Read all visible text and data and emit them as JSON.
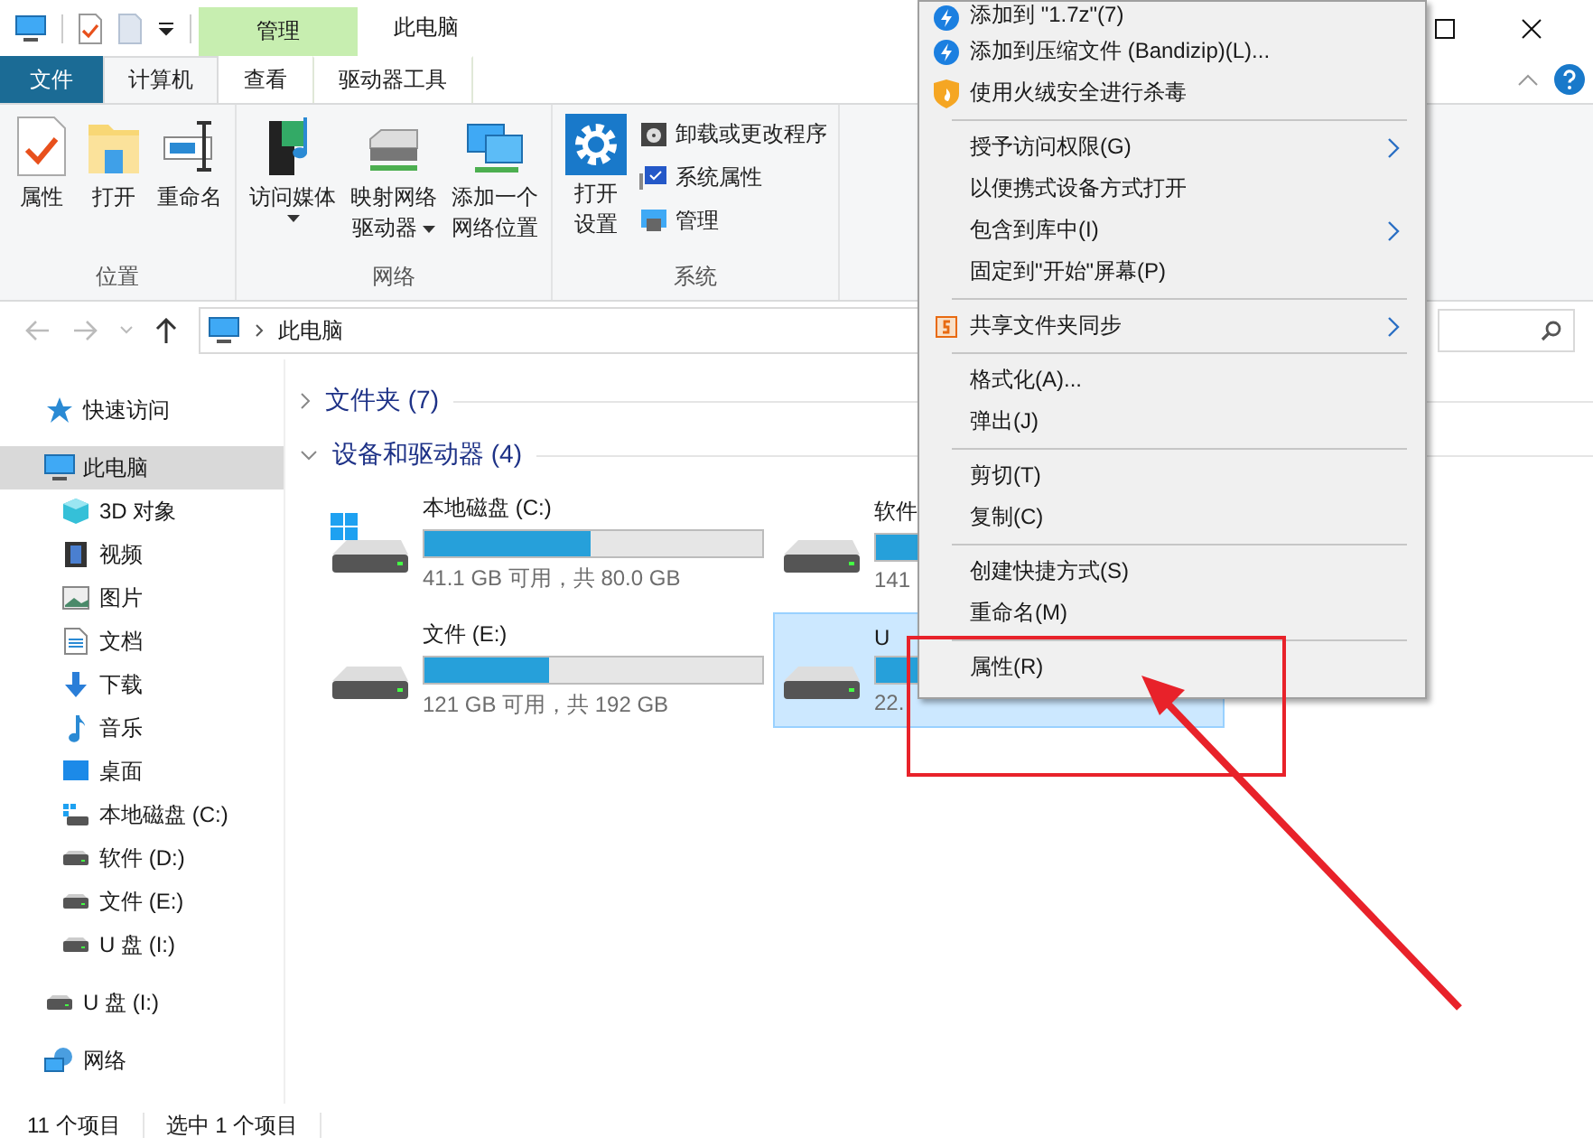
{
  "window": {
    "title": "此电脑",
    "context_tab_group": "管理"
  },
  "tabs": [
    {
      "label": "文件",
      "kind": "file",
      "selected": false
    },
    {
      "label": "计算机",
      "kind": "tab",
      "selected": true
    },
    {
      "label": "查看",
      "kind": "tab",
      "selected": false
    },
    {
      "label": "驱动器工具",
      "kind": "context",
      "selected": false
    }
  ],
  "ribbon": [
    {
      "label": "位置",
      "buttons": [
        {
          "lines": [
            "属性"
          ],
          "kind": "props",
          "dropdown": false
        },
        {
          "lines": [
            "打开"
          ],
          "kind": "folder",
          "dropdown": false
        },
        {
          "lines": [
            "重命名"
          ],
          "kind": "rename",
          "dropdown": false
        }
      ]
    },
    {
      "label": "网络",
      "buttons": [
        {
          "lines": [
            "访问媒体"
          ],
          "kind": "media",
          "dropdown": true
        },
        {
          "lines": [
            "映射网络",
            "驱动器"
          ],
          "kind": "drive",
          "dropdown": true
        },
        {
          "lines": [
            "添加一个",
            "网络位置"
          ],
          "kind": "monitors",
          "dropdown": false
        }
      ]
    },
    {
      "label": "系统",
      "buttons": [
        {
          "lines": [
            "打开",
            "设置"
          ],
          "kind": "gear",
          "dropdown": false
        }
      ],
      "small": [
        {
          "label": "卸载或更改程序",
          "kind": "uninstall"
        },
        {
          "label": "系统属性",
          "kind": "sysprops"
        },
        {
          "label": "管理",
          "kind": "manage"
        }
      ]
    }
  ],
  "address": {
    "path": "此电脑"
  },
  "sidebar": [
    {
      "label": "快速访问",
      "kind": "star",
      "selected": false
    },
    {
      "label": "此电脑",
      "kind": "pc",
      "selected": true,
      "children": [
        {
          "label": "3D 对象",
          "kind": "cube",
          "selected": false
        },
        {
          "label": "视频",
          "kind": "film",
          "selected": false
        },
        {
          "label": "图片",
          "kind": "image",
          "selected": false
        },
        {
          "label": "文档",
          "kind": "doc",
          "selected": false
        },
        {
          "label": "下载",
          "kind": "download",
          "selected": false
        },
        {
          "label": "音乐",
          "kind": "music",
          "selected": false
        },
        {
          "label": "桌面",
          "kind": "desktop",
          "selected": false
        },
        {
          "label": "本地磁盘 (C:)",
          "kind": "windrive",
          "selected": false
        },
        {
          "label": "软件 (D:)",
          "kind": "drive",
          "selected": false
        },
        {
          "label": "文件 (E:)",
          "kind": "drive",
          "selected": false
        },
        {
          "label": "U 盘 (I:)",
          "kind": "drive",
          "selected": false
        }
      ]
    },
    {
      "label": "U 盘 (I:)",
      "kind": "drive",
      "selected": false
    },
    {
      "label": "网络",
      "kind": "network",
      "selected": false
    }
  ],
  "groups": [
    {
      "title": "文件夹 (7)",
      "expanded": false
    },
    {
      "title": "设备和驱动器 (4)",
      "expanded": true
    }
  ],
  "drives": [
    {
      "name": "本地磁盘 (C:)",
      "free": "41.1 GB 可用，共 80.0 GB",
      "level": 0.49,
      "kind": "windrive",
      "selected": false
    },
    {
      "name": "软件",
      "free": "141",
      "kind": "drive",
      "selected": false
    },
    {
      "name": "文件 (E:)",
      "free": "121 GB 可用，共 192 GB",
      "level": 0.37,
      "kind": "drive",
      "selected": false
    },
    {
      "name": "U",
      "free": "22.",
      "kind": "drive",
      "selected": true
    }
  ],
  "context_menu": [
    {
      "label": "添加到 \"1.7z\"(7)",
      "kind": "zip",
      "submenu": false
    },
    {
      "label": "添加到压缩文件 (Bandizip)(L)...",
      "kind": "zip",
      "submenu": false
    },
    {
      "label": "使用火绒安全进行杀毒",
      "kind": "shield",
      "submenu": false
    },
    {
      "kind": "separator"
    },
    {
      "label": "授予访问权限(G)",
      "kind": "plain",
      "submenu": true
    },
    {
      "label": "以便携式设备方式打开",
      "kind": "plain",
      "submenu": false
    },
    {
      "label": "包含到库中(I)",
      "kind": "plain",
      "submenu": true
    },
    {
      "label": "固定到\"开始\"屏幕(P)",
      "kind": "plain",
      "submenu": false
    },
    {
      "kind": "separator"
    },
    {
      "label": "共享文件夹同步",
      "kind": "sync",
      "submenu": true
    },
    {
      "kind": "separator"
    },
    {
      "label": "格式化(A)...",
      "kind": "plain",
      "submenu": false
    },
    {
      "label": "弹出(J)",
      "kind": "plain",
      "submenu": false
    },
    {
      "kind": "separator"
    },
    {
      "label": "剪切(T)",
      "kind": "plain",
      "submenu": false
    },
    {
      "label": "复制(C)",
      "kind": "plain",
      "submenu": false
    },
    {
      "kind": "separator"
    },
    {
      "label": "创建快捷方式(S)",
      "kind": "plain",
      "submenu": false
    },
    {
      "label": "重命名(M)",
      "kind": "plain",
      "submenu": false
    },
    {
      "kind": "separator"
    },
    {
      "label": "属性(R)",
      "kind": "plain",
      "submenu": false
    }
  ],
  "status_bar": [
    "11 个项目",
    "选中 1 个项目"
  ]
}
